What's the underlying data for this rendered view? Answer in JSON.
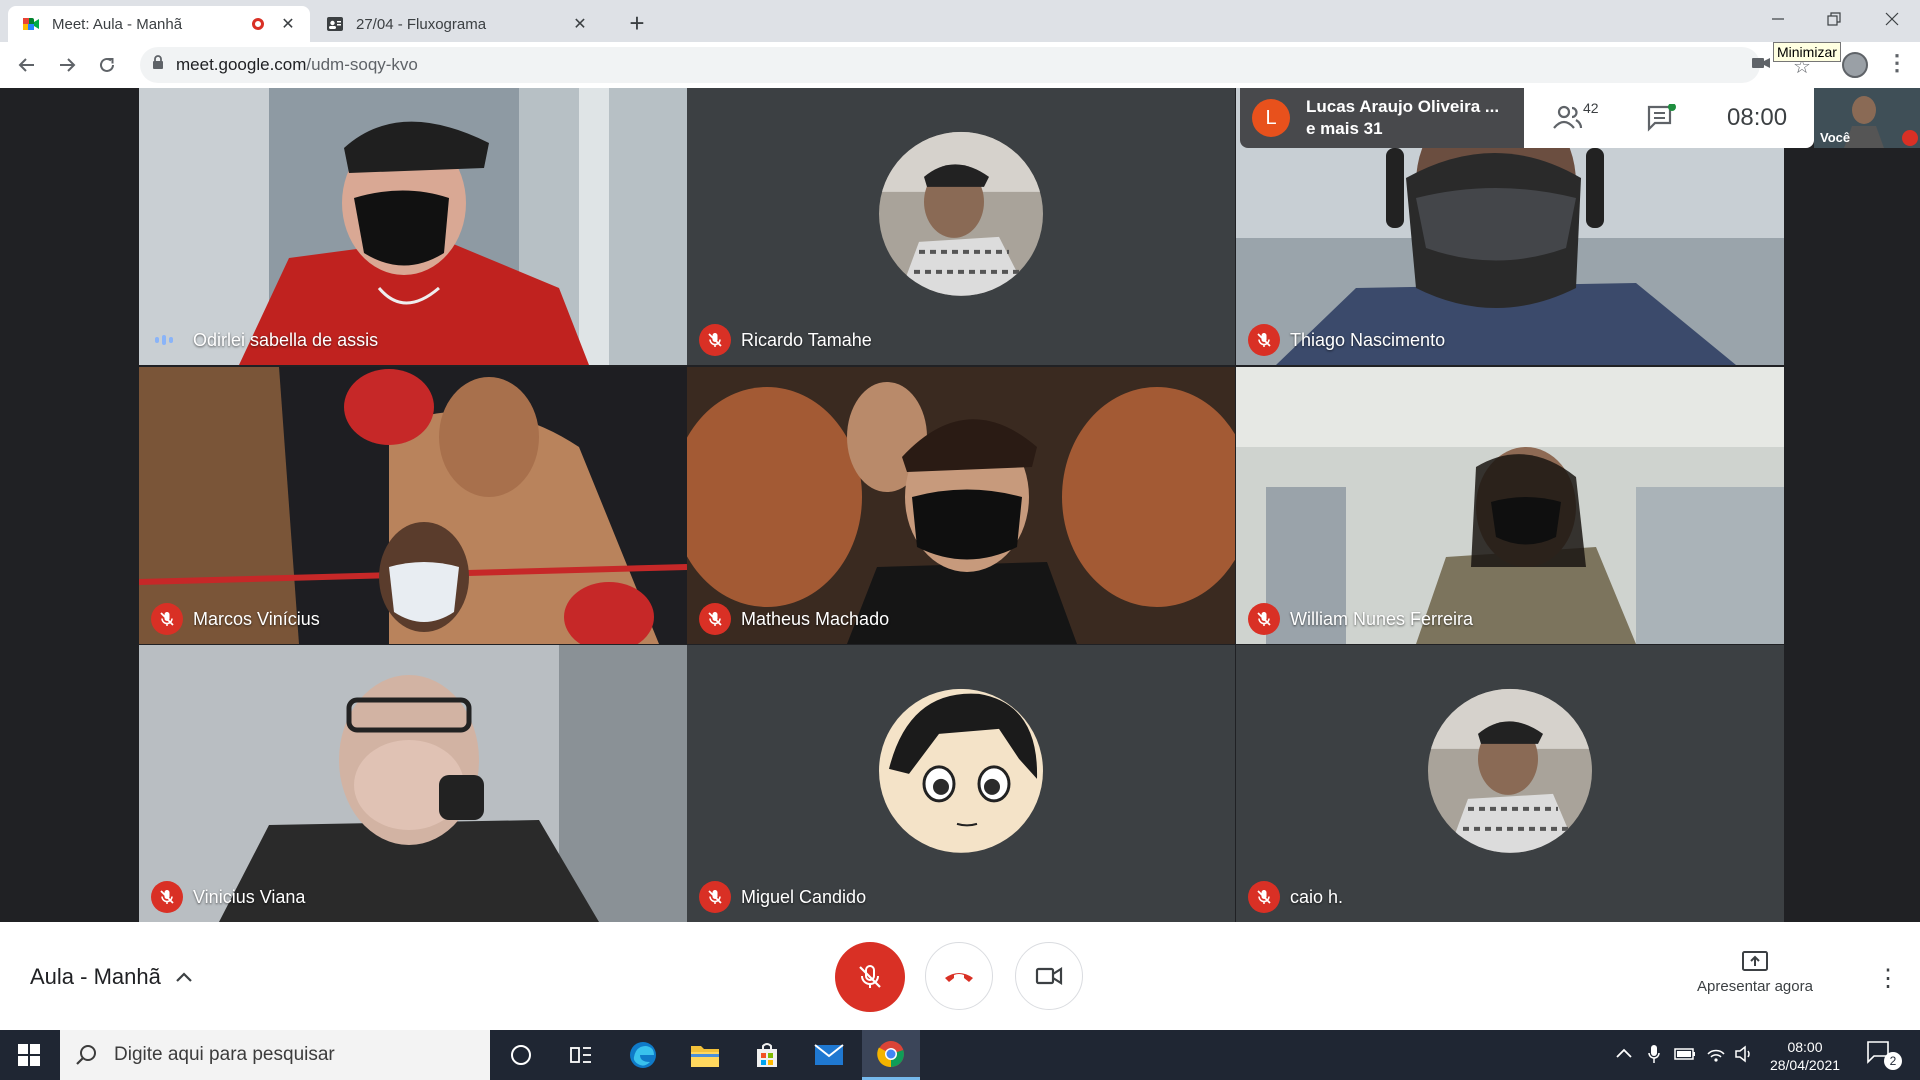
{
  "browser": {
    "tabs": [
      {
        "title": "Meet: Aula - Manhã",
        "active": true,
        "recording": true
      },
      {
        "title": "27/04 - Fluxograma",
        "active": false
      }
    ],
    "new_tab_label": "+",
    "url_host": "meet.google.com",
    "url_path": "/udm-soqy-kvo",
    "tooltip": "Minimizar"
  },
  "meet": {
    "presenter_name": "Lucas Araujo Oliveira ...",
    "presenter_more": "e mais 31",
    "presenter_initial": "L",
    "participants_count": "42",
    "clock": "08:00",
    "self_label": "Você",
    "tiles": [
      {
        "name": "Odirlei sabella de assis",
        "muted": false,
        "kind": "video"
      },
      {
        "name": "Ricardo Tamahe",
        "muted": true,
        "kind": "avatar"
      },
      {
        "name": "Thiago Nascimento",
        "muted": true,
        "kind": "video"
      },
      {
        "name": "Marcos Vinícius",
        "muted": true,
        "kind": "video"
      },
      {
        "name": "Matheus Machado",
        "muted": true,
        "kind": "video"
      },
      {
        "name": "William Nunes Ferreira",
        "muted": true,
        "kind": "video"
      },
      {
        "name": "Vinicius Viana",
        "muted": true,
        "kind": "video"
      },
      {
        "name": "Miguel Candido",
        "muted": true,
        "kind": "avatar"
      },
      {
        "name": "caio h.",
        "muted": true,
        "kind": "avatar"
      }
    ],
    "meeting_title": "Aula - Manhã",
    "present_label": "Apresentar agora"
  },
  "taskbar": {
    "search_placeholder": "Digite aqui para pesquisar",
    "time": "08:00",
    "date": "28/04/2021",
    "notification_count": "2"
  },
  "colors": {
    "accent_red": "#d93025",
    "stage_bg": "#202124",
    "taskbar_bg": "#1f2633",
    "presenter_badge": "#e8511c"
  }
}
